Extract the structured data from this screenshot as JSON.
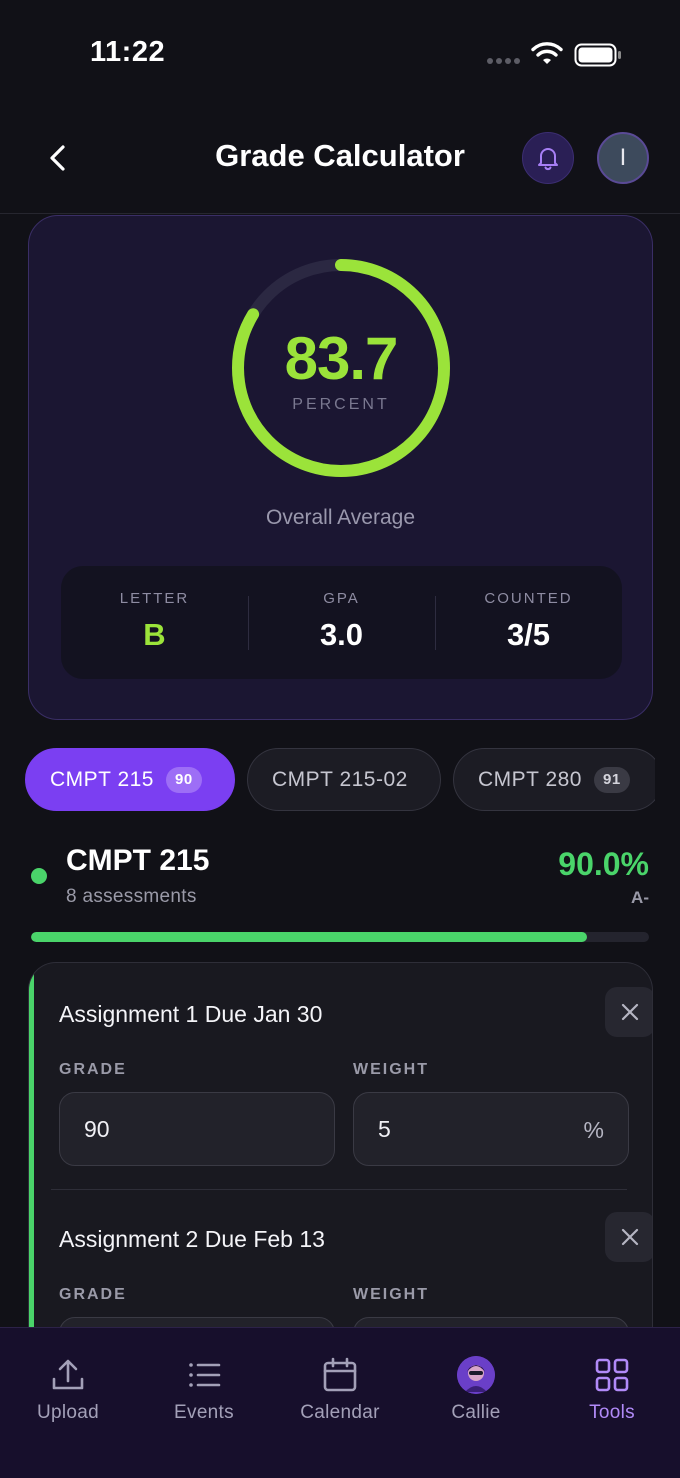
{
  "status_bar": {
    "time": "11:22"
  },
  "header": {
    "title": "Grade Calculator",
    "avatar_initial": "I"
  },
  "overall": {
    "value": "83.7",
    "unit_label": "PERCENT",
    "progress_fraction": 0.837,
    "caption": "Overall Average",
    "stats": [
      {
        "label": "LETTER",
        "value": "B"
      },
      {
        "label": "GPA",
        "value": "3.0"
      },
      {
        "label": "COUNTED",
        "value": "3/5"
      }
    ]
  },
  "course_tabs": [
    {
      "label": "CMPT 215",
      "badge": "90",
      "active": true
    },
    {
      "label": "CMPT 215-02",
      "badge": "",
      "active": false
    },
    {
      "label": "CMPT 280",
      "badge": "91",
      "active": false
    }
  ],
  "course": {
    "title": "CMPT 215",
    "subtitle": "8 assessments",
    "grade": "90.0%",
    "letter": "A-",
    "progress_fraction": 0.9
  },
  "assessments": [
    {
      "name": "Assignment 1 Due Jan 30",
      "grade_label": "GRADE",
      "grade_value": "90",
      "weight_label": "WEIGHT",
      "weight_value": "5",
      "weight_unit": "%"
    },
    {
      "name": "Assignment 2 Due Feb 13",
      "grade_label": "GRADE",
      "grade_value": "",
      "weight_label": "WEIGHT",
      "weight_value": "",
      "weight_unit": ""
    }
  ],
  "nav": [
    {
      "label": "Upload",
      "icon": "upload-icon"
    },
    {
      "label": "Events",
      "icon": "list-icon"
    },
    {
      "label": "Calendar",
      "icon": "calendar-icon"
    },
    {
      "label": "Callie",
      "icon": "callie-avatar"
    },
    {
      "label": "Tools",
      "icon": "grid-icon",
      "active": true
    }
  ],
  "colors": {
    "accent_green": "#9be33a",
    "success_green": "#4ad46a",
    "primary_purple": "#7b3ff2",
    "background": "#111117"
  }
}
